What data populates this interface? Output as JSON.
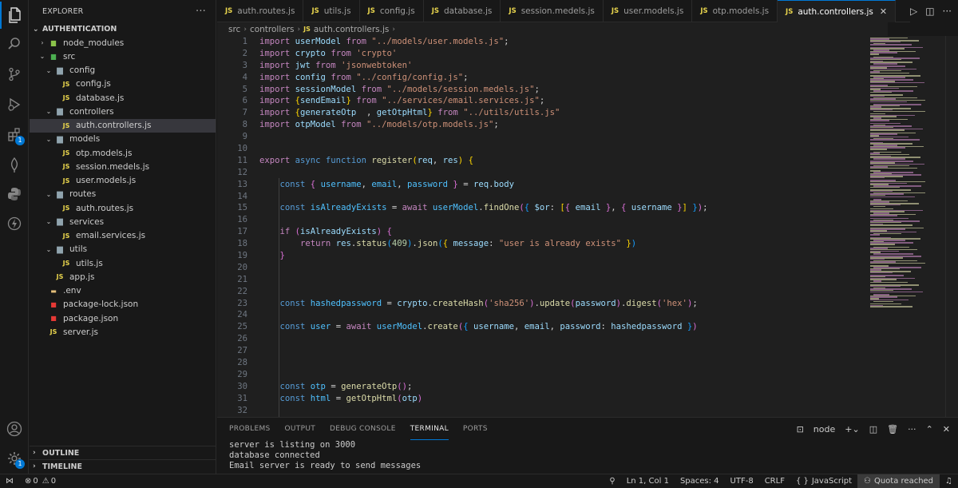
{
  "activity_bar": {
    "extensions_badge": "1",
    "manage_badge": "1"
  },
  "sidebar": {
    "title": "EXPLORER",
    "section": "AUTHENTICATION",
    "tree": [
      {
        "label": "node_modules",
        "type": "folder-nm",
        "depth": 1,
        "chev": "›"
      },
      {
        "label": "src",
        "type": "folder-src",
        "depth": 1,
        "chev": "⌄"
      },
      {
        "label": "config",
        "type": "folder",
        "depth": 2,
        "chev": "⌄"
      },
      {
        "label": "config.js",
        "type": "js",
        "depth": 3,
        "chev": ""
      },
      {
        "label": "database.js",
        "type": "js",
        "depth": 3,
        "chev": ""
      },
      {
        "label": "controllers",
        "type": "folder",
        "depth": 2,
        "chev": "⌄"
      },
      {
        "label": "auth.controllers.js",
        "type": "js",
        "depth": 3,
        "chev": "",
        "selected": true
      },
      {
        "label": "models",
        "type": "folder",
        "depth": 2,
        "chev": "⌄"
      },
      {
        "label": "otp.models.js",
        "type": "js",
        "depth": 3,
        "chev": ""
      },
      {
        "label": "session.medels.js",
        "type": "js",
        "depth": 3,
        "chev": ""
      },
      {
        "label": "user.models.js",
        "type": "js",
        "depth": 3,
        "chev": ""
      },
      {
        "label": "routes",
        "type": "folder",
        "depth": 2,
        "chev": "⌄"
      },
      {
        "label": "auth.routes.js",
        "type": "js",
        "depth": 3,
        "chev": ""
      },
      {
        "label": "services",
        "type": "folder",
        "depth": 2,
        "chev": "⌄"
      },
      {
        "label": "email.services.js",
        "type": "js",
        "depth": 3,
        "chev": ""
      },
      {
        "label": "utils",
        "type": "folder",
        "depth": 2,
        "chev": "⌄"
      },
      {
        "label": "utils.js",
        "type": "js",
        "depth": 3,
        "chev": ""
      },
      {
        "label": "app.js",
        "type": "js",
        "depth": 2,
        "chev": ""
      },
      {
        "label": ".env",
        "type": "env",
        "depth": 1,
        "chev": ""
      },
      {
        "label": "package-lock.json",
        "type": "npm",
        "depth": 1,
        "chev": ""
      },
      {
        "label": "package.json",
        "type": "npm",
        "depth": 1,
        "chev": ""
      },
      {
        "label": "server.js",
        "type": "js",
        "depth": 1,
        "chev": ""
      }
    ],
    "outline": "OUTLINE",
    "timeline": "TIMELINE"
  },
  "tabs": [
    {
      "label": "auth.routes.js"
    },
    {
      "label": "utils.js"
    },
    {
      "label": "config.js"
    },
    {
      "label": "database.js"
    },
    {
      "label": "session.medels.js"
    },
    {
      "label": "user.models.js"
    },
    {
      "label": "otp.models.js"
    },
    {
      "label": "auth.controllers.js",
      "active": true
    }
  ],
  "breadcrumb": [
    "src",
    "controllers",
    "auth.controllers.js"
  ],
  "editor": {
    "line_numbers": [
      "1",
      "2",
      "3",
      "4",
      "5",
      "6",
      "7",
      "8",
      "9",
      "10",
      "11",
      "12",
      "13",
      "14",
      "15",
      "16",
      "17",
      "18",
      "19",
      "20",
      "21",
      "22",
      "23",
      "24",
      "25",
      "26",
      "27",
      "28",
      "29",
      "30",
      "31",
      "32"
    ],
    "lines": [
      [
        [
          "k",
          "import "
        ],
        [
          "v",
          "userModel"
        ],
        [
          "k",
          " from "
        ],
        [
          "s",
          "\"../models/user.models.js\""
        ],
        [
          "t",
          ";"
        ]
      ],
      [
        [
          "k",
          "import "
        ],
        [
          "v",
          "crypto"
        ],
        [
          "k",
          " from "
        ],
        [
          "s",
          "'crypto'"
        ]
      ],
      [
        [
          "k",
          "import "
        ],
        [
          "v",
          "jwt"
        ],
        [
          "k",
          " from "
        ],
        [
          "s",
          "'jsonwebtoken'"
        ]
      ],
      [
        [
          "k",
          "import "
        ],
        [
          "v",
          "config"
        ],
        [
          "k",
          " from "
        ],
        [
          "s",
          "\"../config/config.js\""
        ],
        [
          "t",
          ";"
        ]
      ],
      [
        [
          "k",
          "import "
        ],
        [
          "v",
          "sessionModel"
        ],
        [
          "k",
          " from "
        ],
        [
          "s",
          "\"../models/session.medels.js\""
        ],
        [
          "t",
          ";"
        ]
      ],
      [
        [
          "k",
          "import "
        ],
        [
          "p",
          "{"
        ],
        [
          "v",
          "sendEmail"
        ],
        [
          "p",
          "}"
        ],
        [
          "k",
          " from "
        ],
        [
          "s",
          "\"../services/email.services.js\""
        ],
        [
          "t",
          ";"
        ]
      ],
      [
        [
          "k",
          "import "
        ],
        [
          "p",
          "{"
        ],
        [
          "v",
          "generateOtp  "
        ],
        [
          "t",
          ", "
        ],
        [
          "v",
          "getOtpHtml"
        ],
        [
          "p",
          "}"
        ],
        [
          "k",
          " from "
        ],
        [
          "s",
          "\"../utils/utils.js\""
        ]
      ],
      [
        [
          "k",
          "import "
        ],
        [
          "v",
          "otpModel"
        ],
        [
          "k",
          " from "
        ],
        [
          "s",
          "\"../models/otp.models.js\""
        ],
        [
          "t",
          ";"
        ]
      ],
      [],
      [],
      [
        [
          "k",
          "export "
        ],
        [
          "kw",
          "async function "
        ],
        [
          "f",
          "register"
        ],
        [
          "p",
          "("
        ],
        [
          "v",
          "req"
        ],
        [
          "t",
          ", "
        ],
        [
          "v",
          "res"
        ],
        [
          "p",
          ")"
        ],
        [
          "t",
          " "
        ],
        [
          "p",
          "{"
        ]
      ],
      [],
      [
        [
          "t",
          "    "
        ],
        [
          "kw",
          "const "
        ],
        [
          "p2",
          "{ "
        ],
        [
          "c",
          "username"
        ],
        [
          "t",
          ", "
        ],
        [
          "c",
          "email"
        ],
        [
          "t",
          ", "
        ],
        [
          "c",
          "password"
        ],
        [
          "p2",
          " }"
        ],
        [
          "t",
          " = "
        ],
        [
          "v",
          "req"
        ],
        [
          "t",
          "."
        ],
        [
          "v",
          "body"
        ]
      ],
      [],
      [
        [
          "t",
          "    "
        ],
        [
          "kw",
          "const "
        ],
        [
          "c",
          "isAlreadyExists"
        ],
        [
          "t",
          " = "
        ],
        [
          "k",
          "await "
        ],
        [
          "c",
          "userModel"
        ],
        [
          "t",
          "."
        ],
        [
          "f",
          "findOne"
        ],
        [
          "p2",
          "("
        ],
        [
          "p3",
          "{ "
        ],
        [
          "v",
          "$or"
        ],
        [
          "t",
          ": "
        ],
        [
          "p",
          "["
        ],
        [
          "p2",
          "{ "
        ],
        [
          "v",
          "email"
        ],
        [
          "p2",
          " }"
        ],
        [
          "t",
          ", "
        ],
        [
          "p2",
          "{ "
        ],
        [
          "v",
          "username"
        ],
        [
          "p2",
          " }"
        ],
        [
          "p",
          "]"
        ],
        [
          "p3",
          " }"
        ],
        [
          "p2",
          ")"
        ],
        [
          "t",
          ";"
        ]
      ],
      [],
      [
        [
          "t",
          "    "
        ],
        [
          "k",
          "if "
        ],
        [
          "p2",
          "("
        ],
        [
          "v",
          "isAlreadyExists"
        ],
        [
          "p2",
          ")"
        ],
        [
          "t",
          " "
        ],
        [
          "p2",
          "{"
        ]
      ],
      [
        [
          "t",
          "        "
        ],
        [
          "k",
          "return "
        ],
        [
          "v",
          "res"
        ],
        [
          "t",
          "."
        ],
        [
          "f",
          "status"
        ],
        [
          "p3",
          "("
        ],
        [
          "n",
          "409"
        ],
        [
          "p3",
          ")"
        ],
        [
          "t",
          "."
        ],
        [
          "f",
          "json"
        ],
        [
          "p3",
          "("
        ],
        [
          "p",
          "{ "
        ],
        [
          "v",
          "message"
        ],
        [
          "t",
          ": "
        ],
        [
          "s",
          "\"user is already exists\""
        ],
        [
          "p",
          " }"
        ],
        [
          "p3",
          ")"
        ]
      ],
      [
        [
          "t",
          "    "
        ],
        [
          "p2",
          "}"
        ]
      ],
      [],
      [],
      [],
      [
        [
          "t",
          "    "
        ],
        [
          "kw",
          "const "
        ],
        [
          "c",
          "hashedpassword"
        ],
        [
          "t",
          " = "
        ],
        [
          "v",
          "crypto"
        ],
        [
          "t",
          "."
        ],
        [
          "f",
          "createHash"
        ],
        [
          "p2",
          "("
        ],
        [
          "s",
          "'sha256'"
        ],
        [
          "p2",
          ")"
        ],
        [
          "t",
          "."
        ],
        [
          "f",
          "update"
        ],
        [
          "p2",
          "("
        ],
        [
          "v",
          "password"
        ],
        [
          "p2",
          ")"
        ],
        [
          "t",
          "."
        ],
        [
          "f",
          "digest"
        ],
        [
          "p2",
          "("
        ],
        [
          "s",
          "'hex'"
        ],
        [
          "p2",
          ")"
        ],
        [
          "t",
          ";"
        ]
      ],
      [],
      [
        [
          "t",
          "    "
        ],
        [
          "kw",
          "const "
        ],
        [
          "c",
          "user"
        ],
        [
          "t",
          " = "
        ],
        [
          "k",
          "await "
        ],
        [
          "c",
          "userModel"
        ],
        [
          "t",
          "."
        ],
        [
          "f",
          "create"
        ],
        [
          "p2",
          "("
        ],
        [
          "p3",
          "{ "
        ],
        [
          "v",
          "username"
        ],
        [
          "t",
          ", "
        ],
        [
          "v",
          "email"
        ],
        [
          "t",
          ", "
        ],
        [
          "v",
          "password"
        ],
        [
          "t",
          ": "
        ],
        [
          "v",
          "hashedpassword"
        ],
        [
          "p3",
          " }"
        ],
        [
          "p2",
          ")"
        ]
      ],
      [],
      [],
      [],
      [],
      [
        [
          "t",
          "    "
        ],
        [
          "kw",
          "const "
        ],
        [
          "c",
          "otp"
        ],
        [
          "t",
          " = "
        ],
        [
          "f",
          "generateOtp"
        ],
        [
          "p2",
          "()"
        ],
        [
          "t",
          ";"
        ]
      ],
      [
        [
          "t",
          "    "
        ],
        [
          "kw",
          "const "
        ],
        [
          "c",
          "html"
        ],
        [
          "t",
          " = "
        ],
        [
          "f",
          "getOtpHtml"
        ],
        [
          "p2",
          "("
        ],
        [
          "v",
          "otp"
        ],
        [
          "p2",
          ")"
        ]
      ],
      []
    ]
  },
  "panel": {
    "tabs": [
      "PROBLEMS",
      "OUTPUT",
      "DEBUG CONSOLE",
      "TERMINAL",
      "PORTS"
    ],
    "active_tab": "TERMINAL",
    "terminal_name": "node",
    "terminal_lines": [
      "server is listing on 3000",
      "database connected",
      "Email server is ready to send messages"
    ]
  },
  "statusbar": {
    "errors": "0",
    "warnings": "0",
    "position": "Ln 1, Col 1",
    "spaces": "Spaces: 4",
    "encoding": "UTF-8",
    "eol": "CRLF",
    "language": "JavaScript",
    "quota": "Quota reached"
  },
  "colors": {
    "accent": "#0078d4",
    "background": "#1f1f1f",
    "sidebar": "#181818",
    "js_icon": "#e8d44d"
  }
}
